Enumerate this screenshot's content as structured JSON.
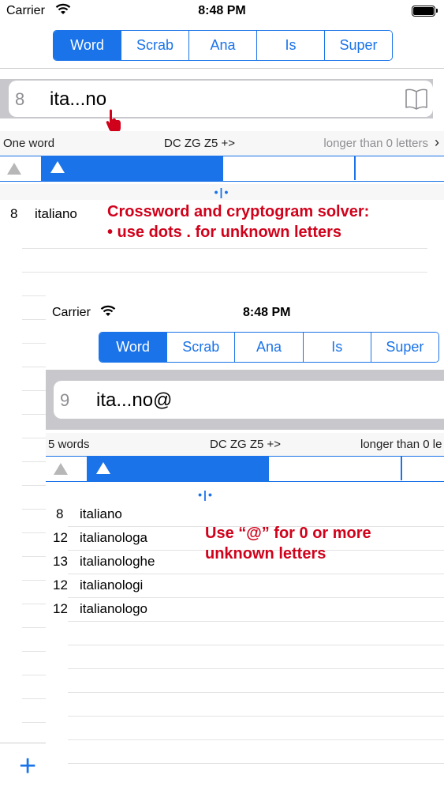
{
  "main": {
    "status": {
      "carrier": "Carrier",
      "time": "8:48 PM"
    },
    "tabs": [
      {
        "label": "Word",
        "active": true
      },
      {
        "label": "Scrab",
        "active": false
      },
      {
        "label": "Ana",
        "active": false
      },
      {
        "label": "Is",
        "active": false
      },
      {
        "label": "Super",
        "active": false
      }
    ],
    "search": {
      "count": "8",
      "query": "ita...no"
    },
    "info": {
      "result_count": "One word",
      "dict": "DC ZG  Z5 +>",
      "filter": "longer than 0 letters"
    },
    "dots": "•|•",
    "results": [
      {
        "len": "8",
        "word": "italiano"
      }
    ],
    "annotation": [
      "Crossword and cryptogram solver:",
      "• use dots . for unknown letters"
    ]
  },
  "inset": {
    "status": {
      "carrier": "Carrier",
      "time": "8:48 PM"
    },
    "tabs": [
      {
        "label": "Word",
        "active": true
      },
      {
        "label": "Scrab",
        "active": false
      },
      {
        "label": "Ana",
        "active": false
      },
      {
        "label": "Is",
        "active": false
      },
      {
        "label": "Super",
        "active": false
      }
    ],
    "search": {
      "count": "9",
      "query": "ita...no@"
    },
    "info": {
      "result_count": "5 words",
      "dict": "DC ZG  Z5 +>",
      "filter": "longer than 0 le"
    },
    "dots": "•|•",
    "results": [
      {
        "len": "8",
        "word": "italiano"
      },
      {
        "len": "12",
        "word": "italianologa"
      },
      {
        "len": "13",
        "word": "italianologhe"
      },
      {
        "len": "12",
        "word": "italianologi"
      },
      {
        "len": "12",
        "word": "italianologo"
      }
    ],
    "annotation": [
      "Use “@” for 0 or more",
      "unknown letters"
    ]
  },
  "add_button": "+",
  "colors": {
    "accent": "#1a73e8",
    "annotation": "#d0021b"
  }
}
